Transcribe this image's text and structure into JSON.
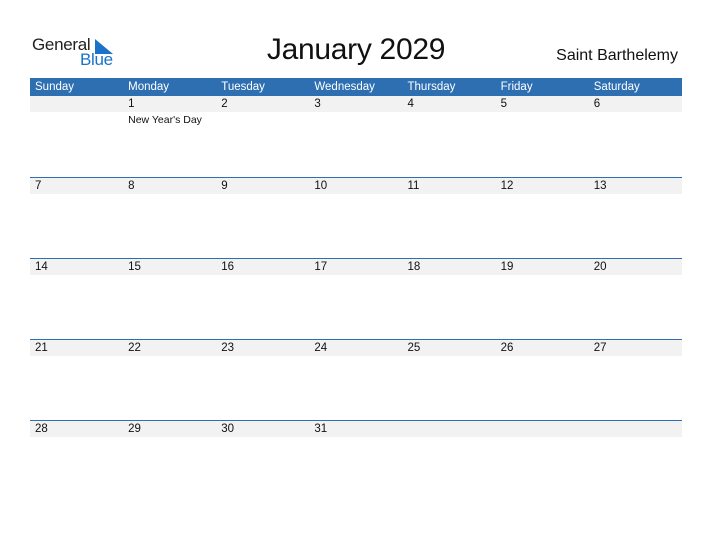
{
  "logo": {
    "line1": "General",
    "line2": "Blue"
  },
  "title": "January 2029",
  "country": "Saint Barthelemy",
  "colors": {
    "header": "#2e6fb2",
    "strip": "#f2f2f2",
    "logo_blue": "#1a73c8"
  },
  "weekdays": [
    "Sunday",
    "Monday",
    "Tuesday",
    "Wednesday",
    "Thursday",
    "Friday",
    "Saturday"
  ],
  "weeks": [
    {
      "days": [
        "",
        "1",
        "2",
        "3",
        "4",
        "5",
        "6"
      ],
      "events": [
        "",
        "New Year's Day",
        "",
        "",
        "",
        "",
        ""
      ]
    },
    {
      "days": [
        "7",
        "8",
        "9",
        "10",
        "11",
        "12",
        "13"
      ],
      "events": [
        "",
        "",
        "",
        "",
        "",
        "",
        ""
      ]
    },
    {
      "days": [
        "14",
        "15",
        "16",
        "17",
        "18",
        "19",
        "20"
      ],
      "events": [
        "",
        "",
        "",
        "",
        "",
        "",
        ""
      ]
    },
    {
      "days": [
        "21",
        "22",
        "23",
        "24",
        "25",
        "26",
        "27"
      ],
      "events": [
        "",
        "",
        "",
        "",
        "",
        "",
        ""
      ]
    },
    {
      "days": [
        "28",
        "29",
        "30",
        "31",
        "",
        "",
        ""
      ],
      "events": [
        "",
        "",
        "",
        "",
        "",
        "",
        ""
      ]
    }
  ]
}
